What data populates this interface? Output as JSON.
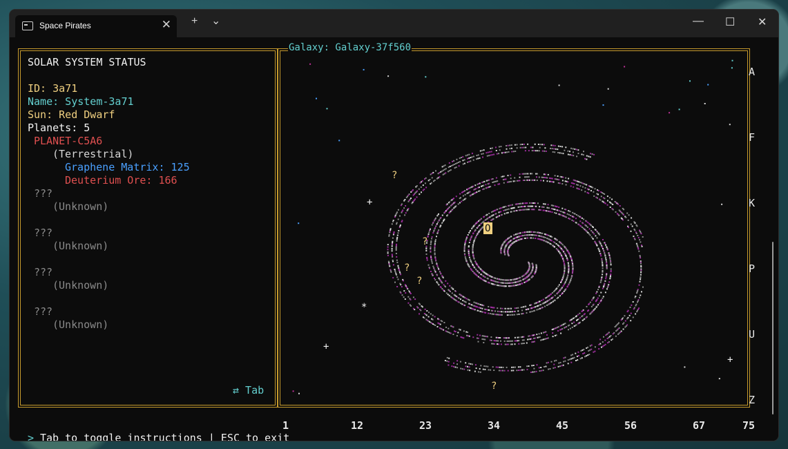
{
  "window": {
    "tab_title": "Space Pirates",
    "new_tab": "+",
    "dropdown": "⌄",
    "close": "✕",
    "minimize": "—",
    "maximize": "☐",
    "win_close": "✕"
  },
  "status": {
    "heading": "SOLAR SYSTEM STATUS",
    "id": "ID: 3a71",
    "name": "Name: System-3a71",
    "sun": "Sun: Red Dwarf",
    "planets": "Planets: 5",
    "planet_name": "PLANET-C5A6",
    "planet_type": "(Terrestrial)",
    "resource1": "Graphene Matrix: 125",
    "resource2": "Deuterium Ore: 166",
    "unknown": [
      {
        "name": "???",
        "type": "(Unknown)"
      },
      {
        "name": "???",
        "type": "(Unknown)"
      },
      {
        "name": "???",
        "type": "(Unknown)"
      },
      {
        "name": "???",
        "type": "(Unknown)"
      }
    ],
    "tab_hint": "⇄ Tab"
  },
  "galaxy": {
    "title": "Galaxy: Galaxy-37f560",
    "row_labels": [
      "A",
      "F",
      "K",
      "P",
      "U",
      "Z"
    ],
    "col_labels": [
      "1",
      "12",
      "23",
      "34",
      "45",
      "56",
      "67",
      "75"
    ],
    "current_marker": "O",
    "unknown_marker": "?",
    "plus_marker": "+",
    "star_marker": "*",
    "colors": {
      "arm_gray": "#8a8a8a",
      "arm_white": "#d8d8d8",
      "arm_purple": "#9b2d9b",
      "marker": "#f0d080"
    }
  },
  "footer": {
    "prompt": ">",
    "instructions": "Tab to toggle instructions | ESC to exit"
  }
}
